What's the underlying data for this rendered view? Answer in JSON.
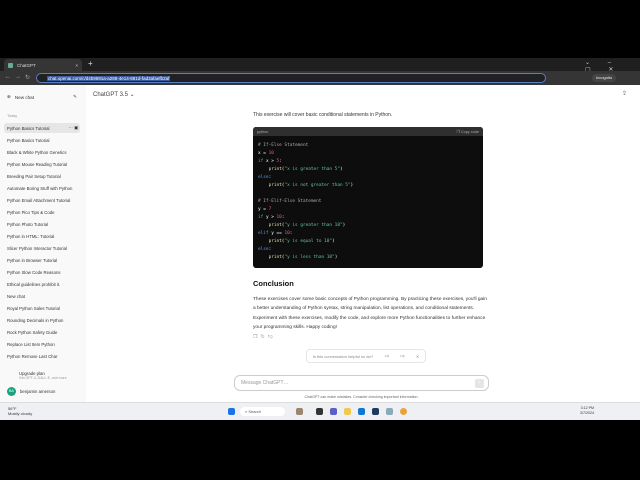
{
  "browser": {
    "tab_title": "ChatGPT",
    "url": "chat.openai.com/c/d4b9691a-a288-4e14-881d-fad3afaefb2af",
    "profile": "Incognito"
  },
  "header": {
    "model": "ChatGPT 3.5"
  },
  "sidebar": {
    "new_chat": "New chat",
    "section": "Today",
    "items": [
      "Python Basics Tutorial",
      "Python Basics Tutorial",
      "Black & White Python Genetics",
      "Python Mouse Reading Tutorial",
      "Breeding Pair Setup Tutorial",
      "Automate Boring Stuff with Python",
      "Python Email Attachment Tutorial",
      "Python Pico Tips & Code",
      "Python Photo Tutorial",
      "Python in HTML: Tutorial",
      "Slicer Python Interactor Tutorial",
      "Python in Browser Tutorial",
      "Python Slow Code Reasons",
      "Ethical guidelines prohibit it.",
      "New chat",
      "Royal Python Sales Tutorial",
      "Rounding Decimals in Python",
      "Rock Python Safety Guide",
      "Replace List Item Python",
      "Python Remove Last Char"
    ],
    "upgrade": "Upgrade plan",
    "upgrade_sub": "Get GPT-4, DALL·E, and more",
    "user": "benjamin amerson",
    "user_initials": "BA"
  },
  "main": {
    "intro": "This exercise will cover basic conditional statements in Python.",
    "code_lang": "python",
    "copy_label": "Copy code",
    "conclusion_title": "Conclusion",
    "conclusion": "These exercises cover some basic concepts of Python programming. By practicing these exercises, you'll gain a better understanding of Python syntax, string manipulation, list operations, and conditional statements. Experiment with these exercises, modify the code, and explore more Python functionalities to further enhance your programming skills. Happy coding!",
    "feedback": "Is this conversation helpful so far?",
    "input_placeholder": "Message ChatGPT…",
    "disclaimer": "ChatGPT can make mistakes. Consider checking important information."
  },
  "taskbar": {
    "weather_temp": "56°F",
    "weather_desc": "Mostly cloudy",
    "search": "Search",
    "time": "3:12 PM",
    "date": "3/7/2024"
  }
}
